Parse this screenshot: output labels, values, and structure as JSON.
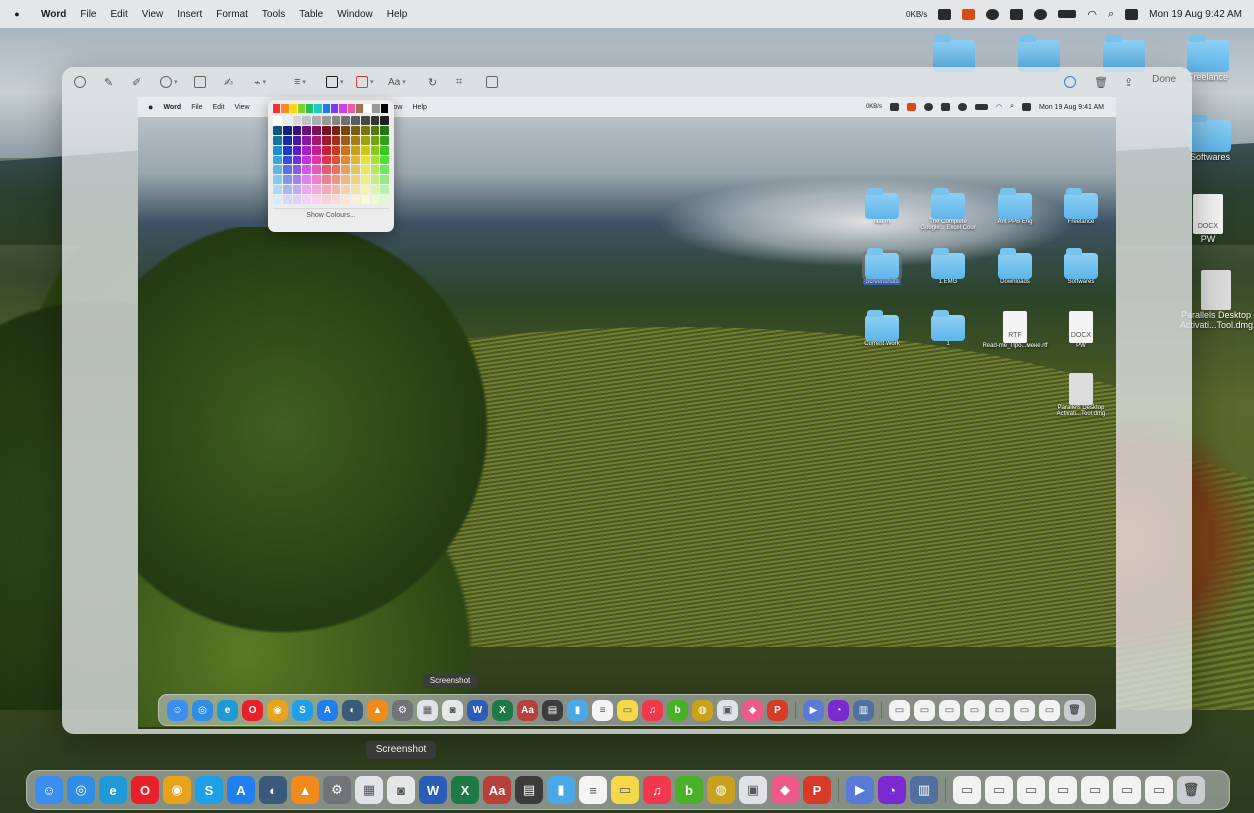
{
  "menubar": {
    "app_name": "Word",
    "menus": [
      "File",
      "Edit",
      "View",
      "Insert",
      "Format",
      "Tools",
      "Table",
      "Window",
      "Help"
    ],
    "network_speed": "0KB/s",
    "datetime": "Mon 19 Aug  9:42 AM"
  },
  "desktop_icons": [
    {
      "label": "",
      "type": "folder"
    },
    {
      "label": "",
      "type": "folder"
    },
    {
      "label": "",
      "type": "folder"
    },
    {
      "label": "Freelance",
      "type": "folder"
    },
    {
      "label": "Softwares",
      "type": "folder"
    },
    {
      "label": "PW",
      "type": "doc",
      "doc_tag": "DOCX"
    },
    {
      "label": "Parallels Desktop Activati...Tool.dmg",
      "type": "dmg"
    }
  ],
  "markup_toolbar": {
    "done_label": "Done"
  },
  "inner_screen": {
    "menubar": {
      "app_name": "Word",
      "menus": [
        "File",
        "Edit",
        "View",
        "Window",
        "Help"
      ],
      "network_speed": "0KB/s",
      "datetime": "Mon 19 Aug  9:41 AM"
    },
    "desktop_icons": [
      {
        "label": "Nat m",
        "type": "folder"
      },
      {
        "label": "The Complete Google... Excel Cour",
        "type": "folder"
      },
      {
        "label": "Ant PPB Eng",
        "type": "folder"
      },
      {
        "label": "Freelance",
        "type": "folder"
      },
      {
        "label": "Screenshots",
        "type": "folder",
        "selected": true
      },
      {
        "label": "1.EMG",
        "type": "folder"
      },
      {
        "label": "Downloads",
        "type": "folder"
      },
      {
        "label": "Softwares",
        "type": "folder"
      },
      {
        "label": "Current Work",
        "type": "folder"
      },
      {
        "label": "1",
        "type": "folder"
      },
      {
        "label": "Read-me_Про...мене.rtf",
        "type": "doc",
        "doc_tag": "RTF"
      },
      {
        "label": "PW",
        "type": "doc",
        "doc_tag": "DOCX"
      },
      {
        "label": "Parallels Desktop Activati...Tool.dmg",
        "type": "dmg"
      }
    ],
    "dock_tooltip": "Screenshot"
  },
  "color_picker": {
    "show_colours_label": "Show Colours...",
    "top_row": [
      "#ff2d2d",
      "#ff8c1a",
      "#ffd21a",
      "#7ad12a",
      "#22c05a",
      "#1fc9c9",
      "#1a7cf0",
      "#7a3cf0",
      "#d33cf0",
      "#f05aa0",
      "#a0744a",
      "#ffffff",
      "#9a9a9a",
      "#000000"
    ]
  },
  "dock": {
    "tooltip": "Screenshot",
    "apps": [
      {
        "name": "finder-icon",
        "color": "#3a8ef0",
        "glyph": "☺"
      },
      {
        "name": "safari-icon",
        "color": "#2f8de6",
        "glyph": "◎"
      },
      {
        "name": "edge-icon",
        "color": "#1f9ad6",
        "glyph": "e"
      },
      {
        "name": "opera-icon",
        "color": "#e8202a",
        "glyph": "O"
      },
      {
        "name": "chrome-icon",
        "color": "#e8a31c",
        "glyph": "◉"
      },
      {
        "name": "skype-icon",
        "color": "#1ea0e8",
        "glyph": "S"
      },
      {
        "name": "app-store-icon",
        "color": "#1f7ff0",
        "glyph": "A"
      },
      {
        "name": "proxyman-icon",
        "color": "#3a5a7a",
        "glyph": "◐"
      },
      {
        "name": "vlc-icon",
        "color": "#f08a1a",
        "glyph": "▲"
      },
      {
        "name": "system-settings-icon",
        "color": "#707478",
        "glyph": "⚙"
      },
      {
        "name": "launchpad-icon",
        "color": "#e0e4e8",
        "glyph": "▦"
      },
      {
        "name": "screenshot-icon",
        "color": "#e4e6e8",
        "glyph": "◙"
      },
      {
        "name": "word-icon",
        "color": "#2b5cb8",
        "glyph": "W"
      },
      {
        "name": "excel-icon",
        "color": "#1e7a45",
        "glyph": "X"
      },
      {
        "name": "dictionary-icon",
        "color": "#b8403a",
        "glyph": "Aa"
      },
      {
        "name": "calculator-icon",
        "color": "#3c3c3c",
        "glyph": "▤"
      },
      {
        "name": "folder-app-icon",
        "color": "#4aa8e8",
        "glyph": "▮"
      },
      {
        "name": "reminders-icon",
        "color": "#f4f4f4",
        "glyph": "≡"
      },
      {
        "name": "notes-icon",
        "color": "#f5d84a",
        "glyph": "▭"
      },
      {
        "name": "music-icon",
        "color": "#f0374c",
        "glyph": "♫"
      },
      {
        "name": "bitdefender-icon",
        "color": "#4ab02a",
        "glyph": "b"
      },
      {
        "name": "globe-app-icon",
        "color": "#c8a21e",
        "glyph": "◍"
      },
      {
        "name": "preview-icon",
        "color": "#dfe3e8",
        "glyph": "▣"
      },
      {
        "name": "creative-cloud-icon",
        "color": "#ec5a8a",
        "glyph": "◆"
      },
      {
        "name": "wps-icon",
        "color": "#d83a2a",
        "glyph": "P"
      },
      {
        "name": "quicktime-icon",
        "color": "#5a7ad8",
        "glyph": "▶"
      },
      {
        "name": "tor-icon",
        "color": "#7a2ad0",
        "glyph": "◔"
      },
      {
        "name": "screen-sharing-icon",
        "color": "#5070a0",
        "glyph": "▥"
      },
      {
        "name": "stack-thumb-1-icon",
        "color": "#f2f2f2",
        "glyph": "▭"
      },
      {
        "name": "stack-thumb-2-icon",
        "color": "#f2f2f2",
        "glyph": "▭"
      },
      {
        "name": "stack-thumb-3-icon",
        "color": "#f2f2f2",
        "glyph": "▭"
      },
      {
        "name": "stack-thumb-4-icon",
        "color": "#f2f2f2",
        "glyph": "▭"
      },
      {
        "name": "stack-thumb-5-icon",
        "color": "#f2f2f2",
        "glyph": "▭"
      },
      {
        "name": "stack-thumb-6-icon",
        "color": "#f2f2f2",
        "glyph": "▭"
      },
      {
        "name": "stack-thumb-7-icon",
        "color": "#f2f2f2",
        "glyph": "▭"
      },
      {
        "name": "trash-icon",
        "color": "#c9ccd0",
        "glyph": "🗑"
      }
    ]
  }
}
